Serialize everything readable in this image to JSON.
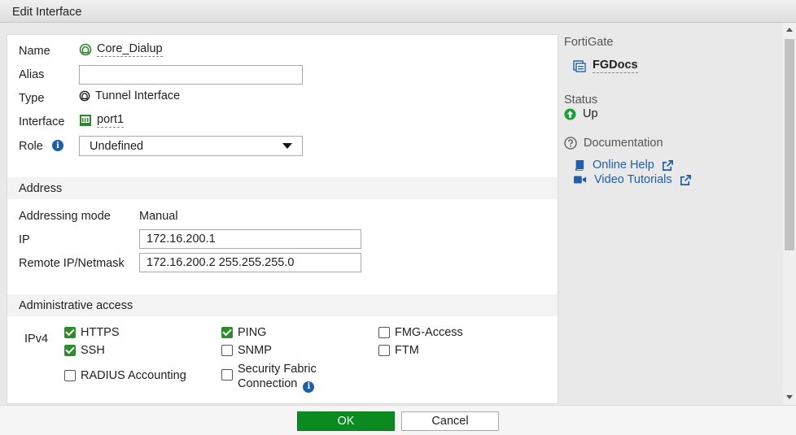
{
  "window": {
    "title": "Edit Interface"
  },
  "form": {
    "name_label": "Name",
    "name_value": "Core_Dialup",
    "alias_label": "Alias",
    "alias_value": "",
    "type_label": "Type",
    "type_value": "Tunnel Interface",
    "interface_label": "Interface",
    "interface_value": "port1",
    "role_label": "Role",
    "role_value": "Undefined"
  },
  "address": {
    "header": "Address",
    "mode_label": "Addressing mode",
    "mode_value": "Manual",
    "ip_label": "IP",
    "ip_value": "172.16.200.1",
    "remote_label": "Remote IP/Netmask",
    "remote_value": "172.16.200.2 255.255.255.0"
  },
  "admin": {
    "header": "Administrative access",
    "ipv4_label": "IPv4",
    "options": [
      {
        "label": "HTTPS",
        "checked": true
      },
      {
        "label": "PING",
        "checked": true
      },
      {
        "label": "FMG-Access",
        "checked": false
      },
      {
        "label": "SSH",
        "checked": true
      },
      {
        "label": "SNMP",
        "checked": false
      },
      {
        "label": "FTM",
        "checked": false
      },
      {
        "label": "RADIUS Accounting",
        "checked": false
      },
      {
        "label": "Security Fabric",
        "label2": "Connection",
        "checked": false
      }
    ]
  },
  "sidebar": {
    "device_header": "FortiGate",
    "device_name": "FGDocs",
    "status_header": "Status",
    "status_value": "Up",
    "doc_header": "Documentation",
    "online_help": "Online Help",
    "video_tutorials": "Video Tutorials"
  },
  "footer": {
    "ok_label": "OK",
    "cancel_label": "Cancel"
  },
  "colors": {
    "ok_green": "#0a8a1f",
    "check_green": "#2e8b2e",
    "link_blue": "#1f5ea8",
    "status_up": "#1e9e3a"
  }
}
